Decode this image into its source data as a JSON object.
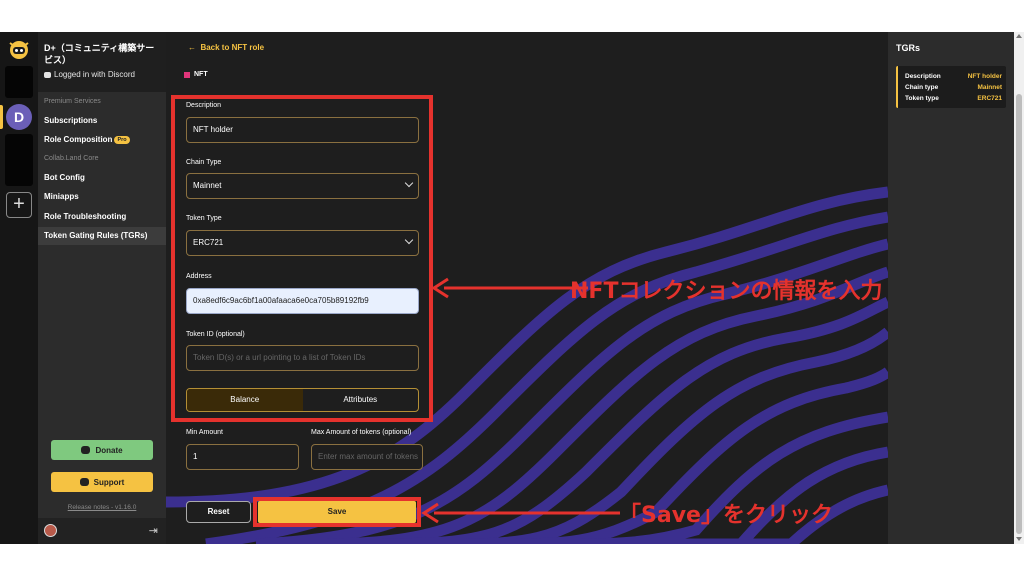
{
  "server": {
    "name": "D+（コミュニティ構築サービス）",
    "login_status": "Logged in with Discord",
    "server_initial": "D"
  },
  "sidebar": {
    "section_premium": "Premium Services",
    "section_core": "Collab.Land Core",
    "items": [
      {
        "label": "Subscriptions"
      },
      {
        "label": "Role Composition",
        "badge": "Pro"
      },
      {
        "label": "Bot Config"
      },
      {
        "label": "Miniapps"
      },
      {
        "label": "Role Troubleshooting"
      },
      {
        "label": "Token Gating Rules (TGRs)"
      }
    ],
    "donate_label": "Donate",
    "support_label": "Support",
    "release_notes": "Release notes - v1.16.0"
  },
  "main": {
    "back_label": "Back to NFT role",
    "section_tag": "NFT",
    "description": {
      "label": "Description",
      "value": "NFT holder"
    },
    "chain_type": {
      "label": "Chain Type",
      "value": "Mainnet"
    },
    "token_type": {
      "label": "Token Type",
      "value": "ERC721"
    },
    "address": {
      "label": "Address",
      "value": "0xa8edf6c9ac6bf1a00afaaca6e0ca705b89192fb9"
    },
    "token_id": {
      "label": "Token ID (optional)",
      "placeholder": "Token ID(s) or a url pointing to a list of Token IDs"
    },
    "tabs": [
      {
        "label": "Balance",
        "active": true
      },
      {
        "label": "Attributes",
        "active": false
      }
    ],
    "min_amount": {
      "label": "Min Amount",
      "value": "1"
    },
    "max_amount": {
      "label": "Max Amount of tokens (optional)",
      "placeholder": "Enter max amount of tokens"
    },
    "reset_label": "Reset",
    "save_label": "Save"
  },
  "annotations": {
    "input_note": "NFTコレクションの情報を入力",
    "save_note": "「Save」をクリック"
  },
  "right_panel": {
    "title": "TGRs",
    "rows": [
      {
        "key": "Description",
        "value": "NFT holder"
      },
      {
        "key": "Chain type",
        "value": "Mainnet"
      },
      {
        "key": "Token type",
        "value": "ERC721"
      }
    ]
  },
  "colors": {
    "accent": "#f5c242",
    "annotation": "#e5322d",
    "wave": "#3b2f8f",
    "nft_tag": "#e0357a"
  }
}
